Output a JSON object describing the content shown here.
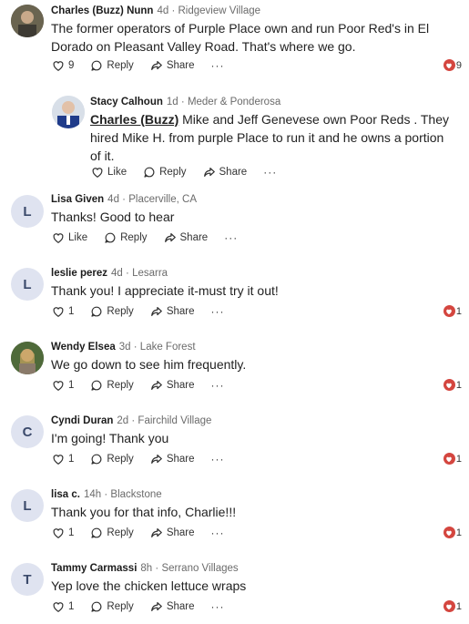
{
  "comments": [
    {
      "name": "Charles (Buzz) Nunn",
      "time": "4d",
      "location": "Ridgeview Village",
      "line1": "The former operators of Purple Place own and run Poor Red's in El",
      "line2": "Dorado on Pleasant Valley Road. That's where we go.",
      "like": "9",
      "reply": "Reply",
      "share": "Share",
      "more": "···",
      "reactions": "9"
    },
    {
      "name": "Stacy Calhoun",
      "time": "1d",
      "location": "Meder & Ponderosa",
      "mention": "Charles (Buzz)",
      "line1": " Mike and Jeff Genevese own Poor Reds .  They",
      "line2": "hired Mike H. from purple Place to run it and he owns a portion",
      "line3": "of it.",
      "like": "Like",
      "reply": "Reply",
      "share": "Share",
      "more": "···"
    },
    {
      "name": "Lisa Given",
      "time": "4d",
      "location": "Placerville, CA",
      "initial": "L",
      "line1": "Thanks!  Good to hear",
      "like": "Like",
      "reply": "Reply",
      "share": "Share",
      "more": "···"
    },
    {
      "name": "leslie perez",
      "time": "4d",
      "location": "Lesarra",
      "initial": "L",
      "line1": "Thank you! I appreciate it-must try it out!",
      "like": "1",
      "reply": "Reply",
      "share": "Share",
      "more": "···",
      "reactions": "1"
    },
    {
      "name": "Wendy Elsea",
      "time": "3d",
      "location": "Lake Forest",
      "line1": "We go down to see him frequently.",
      "like": "1",
      "reply": "Reply",
      "share": "Share",
      "more": "···",
      "reactions": "1"
    },
    {
      "name": "Cyndi Duran",
      "time": "2d",
      "location": "Fairchild Village",
      "initial": "C",
      "line1": "I'm going!  Thank you",
      "like": "1",
      "reply": "Reply",
      "share": "Share",
      "more": "···",
      "reactions": "1"
    },
    {
      "name": "lisa c.",
      "time": "14h",
      "location": "Blackstone",
      "initial": "L",
      "line1": "Thank you for that info, Charlie!!!",
      "like": "1",
      "reply": "Reply",
      "share": "Share",
      "more": "···",
      "reactions": "1"
    },
    {
      "name": "Tammy Carmassi",
      "time": "8h",
      "location": "Serrano Villages",
      "initial": "T",
      "line1": "Yep love the chicken lettuce wraps",
      "like": "1",
      "reply": "Reply",
      "share": "Share",
      "more": "···",
      "reactions": "1"
    }
  ],
  "colors": {
    "heart": "#d4463f",
    "avatar_bg": "#dfe3f0",
    "text": "#222222",
    "meta": "#6b6b6b"
  }
}
